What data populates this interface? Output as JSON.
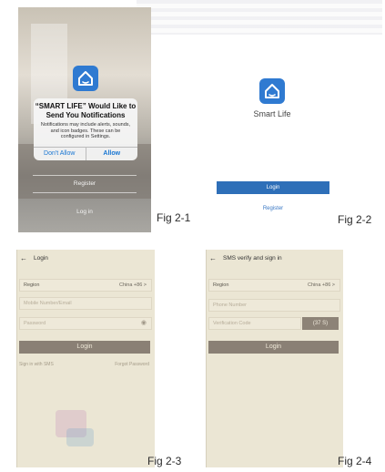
{
  "fig1": {
    "dialog_title": "“SMART LIFE” Would Like to Send You Notifications",
    "dialog_message": "Notifications may include alerts, sounds, and icon badges. These can be configured in Settings.",
    "dont_allow": "Don't Allow",
    "allow": "Allow",
    "register": "Register",
    "login": "Log in",
    "caption": "Fig 2-1"
  },
  "fig2": {
    "app_name": "Smart Life",
    "login_button": "Login",
    "register_link": "Register",
    "caption": "Fig 2-2"
  },
  "fig3": {
    "back_arrow": "←",
    "title": "Login",
    "region_label": "Region",
    "region_value": "China +86  >",
    "mobile_placeholder": "Mobile Number/Email",
    "password_placeholder": "Password",
    "login_button": "Login",
    "sms_link": "Sign in with SMS",
    "forgot_link": "Forgot Password",
    "caption": "Fig 2-3"
  },
  "fig4": {
    "back_arrow": "←",
    "title": "SMS verify and sign in",
    "region_label": "Region",
    "region_value": "China +86  >",
    "phone_placeholder": "Phone Number",
    "code_placeholder": "Verification Code",
    "code_button": "(37 S)",
    "login_button": "Login",
    "caption": "Fig 2-4"
  },
  "colors": {
    "brand_blue": "#2f7ad1",
    "login_blue": "#2e6fb8",
    "sms_bg": "#ebe6d4",
    "dark_button": "#8a8075"
  },
  "icons": [
    "home-icon",
    "eye-icon",
    "back-arrow-icon"
  ]
}
